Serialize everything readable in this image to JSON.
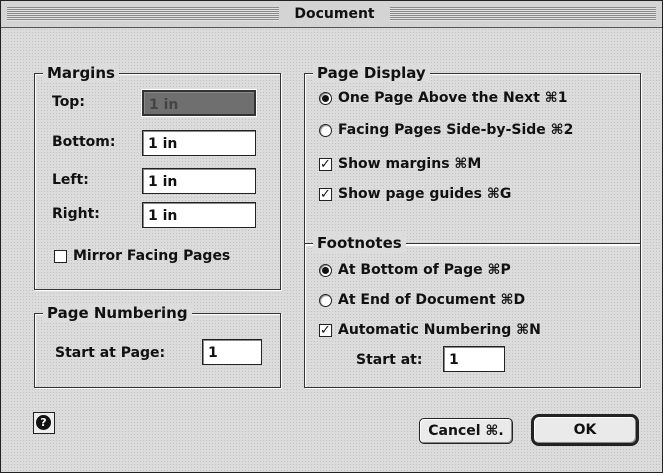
{
  "window": {
    "title": "Document"
  },
  "margins": {
    "legend": "Margins",
    "top": {
      "label": "Top:",
      "value": "1 in"
    },
    "bottom": {
      "label": "Bottom:",
      "value": "1 in"
    },
    "left": {
      "label": "Left:",
      "value": "1 in"
    },
    "right": {
      "label": "Right:",
      "value": "1 in"
    },
    "mirror": {
      "label": "Mirror Facing Pages",
      "checked": false
    }
  },
  "page_numbering": {
    "legend": "Page Numbering",
    "start_label": "Start at Page:",
    "start_value": "1"
  },
  "page_display": {
    "legend": "Page Display",
    "option1": {
      "label": "One Page Above the Next ⌘1",
      "selected": true
    },
    "option2": {
      "label": "Facing Pages Side-by-Side ⌘2",
      "selected": false
    },
    "show_margins": {
      "label": "Show margins ⌘M",
      "checked": true
    },
    "show_guides": {
      "label": "Show page guides ⌘G",
      "checked": true
    }
  },
  "footnotes": {
    "legend": "Footnotes",
    "bottom_of_page": {
      "label": "At Bottom of Page ⌘P",
      "selected": true
    },
    "end_of_doc": {
      "label": "At End of Document ⌘D",
      "selected": false
    },
    "auto_numbering": {
      "label": "Automatic Numbering ⌘N",
      "checked": true
    },
    "start_label": "Start at:",
    "start_value": "1"
  },
  "buttons": {
    "help_icon": "help-icon",
    "cancel": "Cancel ⌘.",
    "ok": "OK"
  }
}
